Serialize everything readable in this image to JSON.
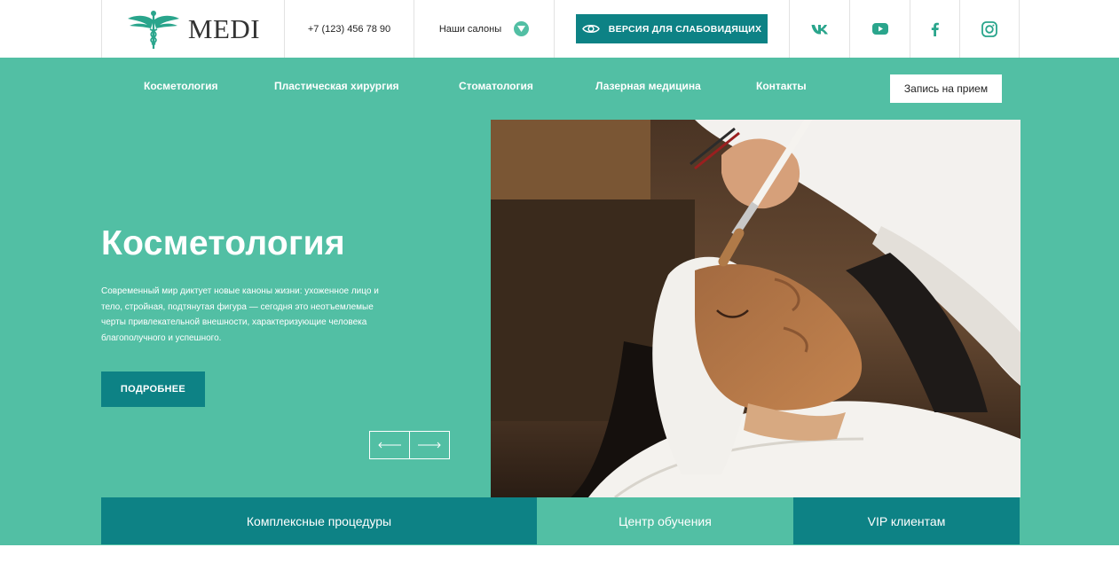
{
  "brand": {
    "name": "MEDI",
    "accent": "#52bfa4",
    "dark_accent": "#0d8285"
  },
  "topbar": {
    "phone": "+7 (123) 456 78 90",
    "salons_label": "Наши салоны",
    "low_vision_label": "ВЕРСИЯ ДЛЯ СЛАБОВИДЯЩИХ",
    "icons": [
      "caduceus-icon",
      "chevron-down-icon",
      "eye-icon",
      "vk-icon",
      "youtube-icon",
      "facebook-icon",
      "instagram-icon"
    ]
  },
  "nav": {
    "items": [
      {
        "label": "Косметология"
      },
      {
        "label": "Пластическая хирургия"
      },
      {
        "label": "Стоматология"
      },
      {
        "label": "Лазерная медицина"
      },
      {
        "label": "Контакты"
      }
    ],
    "appointment_label": "Запись на прием"
  },
  "hero": {
    "title": "Косметология",
    "description": "Современный мир диктует новые каноны жизни: ухоженное лицо и тело, стройная, подтянутая фигура — сегодня это неотъемлемые черты привлекательной внешности, характеризующие человека благополучного и успешного.",
    "more_label": "ПОДРОБНЕЕ",
    "prev_arrow": "⟵",
    "next_arrow": "⟶"
  },
  "tabs": [
    {
      "label": "Комплексные процедуры"
    },
    {
      "label": "Центр обучения"
    },
    {
      "label": "VIP клиентам"
    }
  ]
}
